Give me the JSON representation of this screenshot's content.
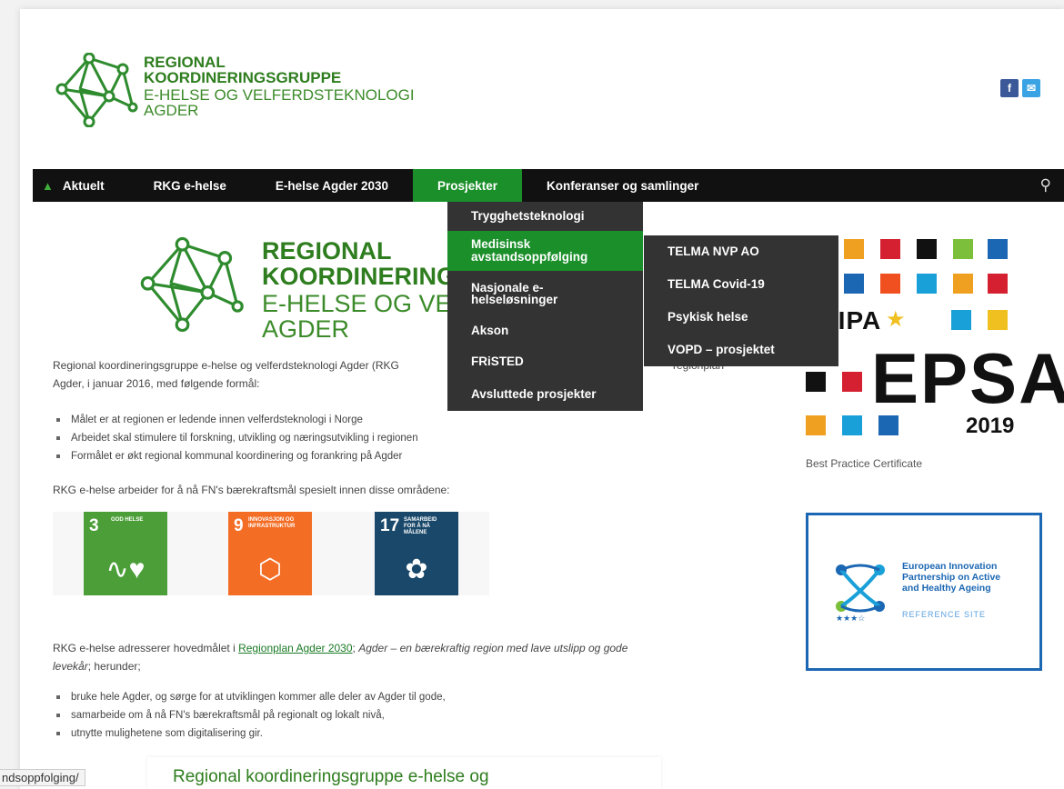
{
  "header": {
    "logo_title_1": "REGIONAL",
    "logo_title_2": "KOORDINERINGSGRUPPE",
    "logo_sub_1": "E-HELSE OG VELFERDSTEKNOLOGI",
    "logo_sub_2": "AGDER",
    "social": {
      "facebook": "f",
      "email": "✉"
    }
  },
  "nav": {
    "items": [
      "Aktuelt",
      "RKG e-helse",
      "E-helse Agder 2030",
      "Prosjekter",
      "Konferanser og samlinger"
    ],
    "active": "Prosjekter"
  },
  "dropdown": {
    "items": [
      "Trygghetsteknologi",
      "Medisinsk avstandsoppfølging",
      "Nasjonale e-helseløsninger",
      "Akson",
      "FRiSTED",
      "Avsluttede prosjekter"
    ],
    "active": "Medisinsk avstandsoppfølging",
    "submenu": [
      "TELMA NVP AO",
      "TELMA Covid-19",
      "Psykisk helse",
      "VOPD – prosjektet"
    ]
  },
  "main": {
    "big_logo_title_1": "REGIONAL",
    "big_logo_title_2": "KOORDINERING",
    "big_logo_sub_1": "E-HELSE OG VEL",
    "big_logo_sub_2": "AGDER",
    "intro_line1": "Regional koordineringsgruppe e-helse og velferdsteknologi Agder (RKG",
    "intro_line1_end": "regionplan",
    "intro_line2": "Agder, i januar 2016, med følgende formål:",
    "goals": [
      "Målet er at regionen er ledende innen velferdsteknologi i Norge",
      "Arbeidet skal stimulere til forskning, utvikling og næringsutvikling i regionen",
      "Formålet er økt regional kommunal koordinering og forankring på Agder"
    ],
    "sdg_intro": "RKG e-helse arbeider for å nå FN's bærekraftsmål spesielt innen disse områdene:",
    "sdgs": [
      {
        "num": "3",
        "label": "GOD HELSE",
        "color": "#4c9f38"
      },
      {
        "num": "9",
        "label": "INNOVASJON OG INFRASTRUKTUR",
        "color": "#f36d25"
      },
      {
        "num": "17",
        "label": "SAMARBEID FOR Å NÅ MÅLENE",
        "color": "#19486a"
      }
    ],
    "address_prefix": "RKG e-helse adresserer hovedmålet i ",
    "address_link": "Regionplan Agder 2030",
    "address_sep": "; ",
    "address_italic": "Agder – en bærekraftig region med lave utslipp og gode",
    "address_italic2": "levekår",
    "address_suffix": "; herunder;",
    "aims": [
      "bruke hele Agder, og sørge for at utviklingen kommer alle deler av Agder til gode,",
      "samarbeide om å nå FN's bærekraftsmål på regionalt og lokalt nivå,",
      "utnytte mulighetene som digitalisering gir."
    ]
  },
  "sidebar": {
    "eipa_text": "EIPA",
    "epsa_text": "EPSA",
    "epsa_year": "2019",
    "caption": "Best Practice Certificate",
    "eip_text_1": "European Innovation",
    "eip_text_2": "Partnership on Active",
    "eip_text_3": "and Healthy Ageing",
    "eip_ref": "REFERENCE SITE"
  },
  "status": {
    "url_tooltip": "ndsoppfolging/",
    "bottom_title": "Regional koordineringsgruppe e-helse og"
  }
}
